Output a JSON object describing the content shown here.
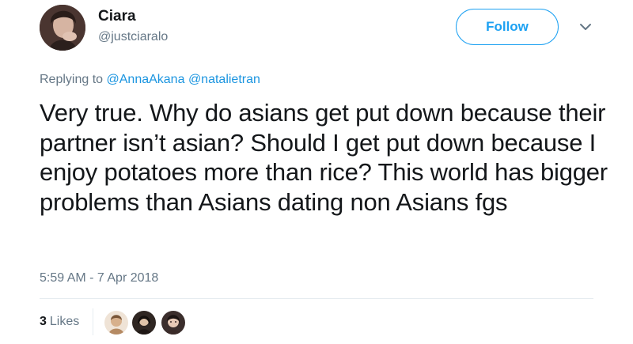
{
  "author": {
    "display_name": "Ciara",
    "handle": "@justciaralo"
  },
  "follow_button_label": "Follow",
  "reply": {
    "prefix": "Replying to",
    "mentions": [
      "@AnnaAkana",
      "@natalietran"
    ]
  },
  "tweet_text": "Very true. Why do asians get put down because their partner isn’t asian? Should I get put down because I enjoy potatoes more than rice? This world has bigger problems than Asians dating non Asians fgs",
  "timestamp": "5:59 AM - 7 Apr 2018",
  "likes": {
    "count": "3",
    "label": "Likes"
  },
  "icons": {
    "caret": "chevron-down-icon"
  },
  "colors": {
    "accent": "#1da1f2",
    "text": "#14171a",
    "muted": "#657786",
    "link": "#1b95e0"
  }
}
